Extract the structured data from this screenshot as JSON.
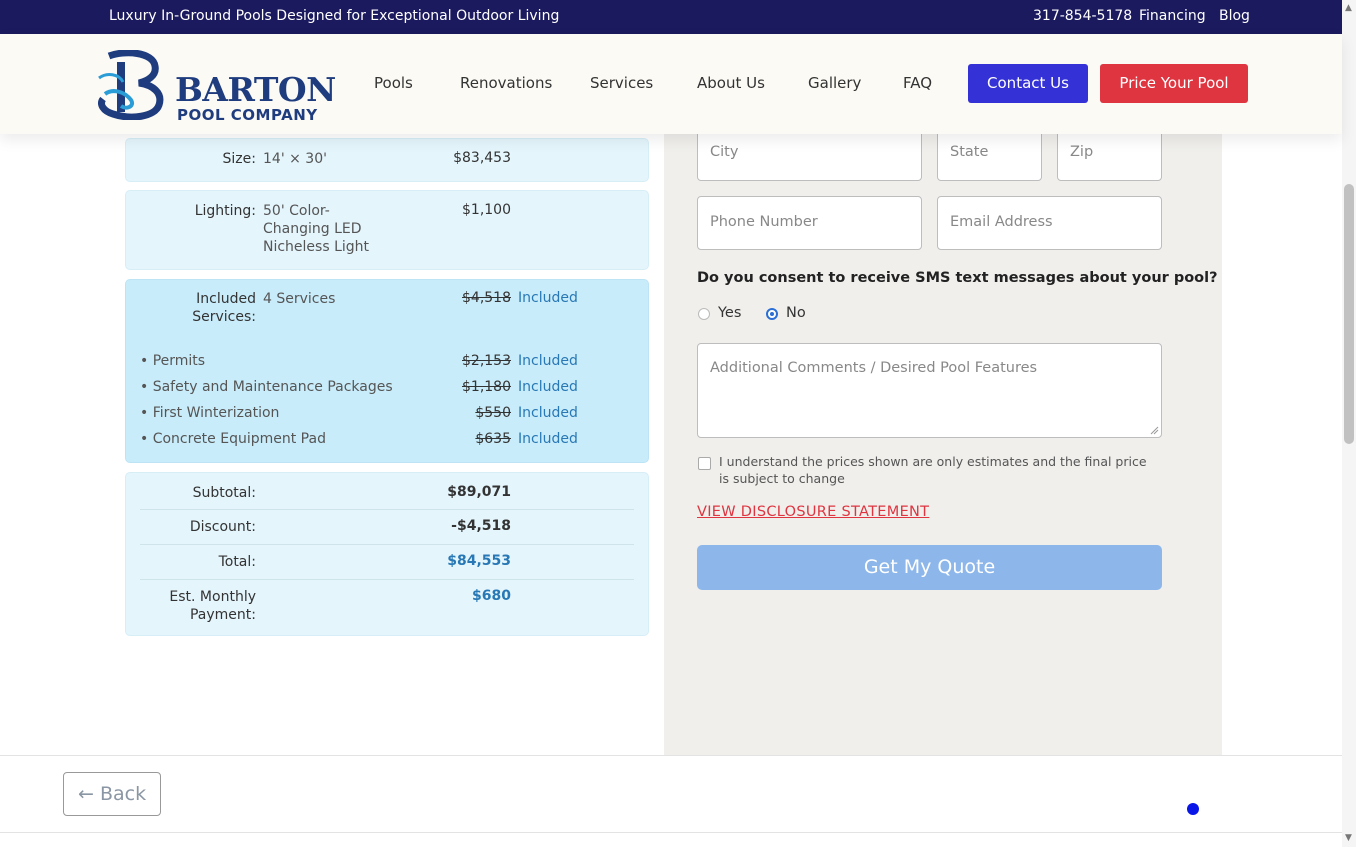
{
  "topbar": {
    "tagline": "Luxury In-Ground Pools Designed for Exceptional Outdoor Living",
    "phone": "317-854-5178",
    "financing": "Financing",
    "blog": "Blog"
  },
  "logo": {
    "line1": "BARTON",
    "line2": "POOL COMPANY"
  },
  "nav": {
    "items": [
      "Pools",
      "Renovations",
      "Services",
      "About Us",
      "Gallery",
      "FAQ"
    ],
    "contact": "Contact Us",
    "price": "Price Your Pool"
  },
  "summary": {
    "size": {
      "label": "Size:",
      "desc": "14' × 30'",
      "price": "$83,453"
    },
    "lighting": {
      "label": "Lighting:",
      "desc": "50' Color-Changing LED Nicheless Light",
      "price": "$1,100"
    },
    "included": {
      "label": "Included Services:",
      "desc": "4 Services",
      "price": "$4,518",
      "status": "Included",
      "items": [
        {
          "name": "• Permits",
          "price": "$2,153",
          "status": "Included"
        },
        {
          "name": "• Safety and Maintenance Packages",
          "price": "$1,180",
          "status": "Included"
        },
        {
          "name": "• First Winterization",
          "price": "$550",
          "status": "Included"
        },
        {
          "name": "• Concrete Equipment Pad",
          "price": "$635",
          "status": "Included"
        }
      ]
    },
    "totals": {
      "subtotal_label": "Subtotal:",
      "subtotal": "$89,071",
      "discount_label": "Discount:",
      "discount": "-$4,518",
      "total_label": "Total:",
      "total": "$84,553",
      "monthly_label": "Est. Monthly Payment:",
      "monthly": "$680"
    }
  },
  "form": {
    "city": "City",
    "state": "State",
    "zip": "Zip",
    "phone": "Phone Number",
    "email": "Email Address",
    "sms_question": "Do you consent to receive SMS text messages about your pool?",
    "sms_yes": "Yes",
    "sms_no": "No",
    "sms_selected": "No",
    "comments": "Additional Comments / Desired Pool Features",
    "ack": "I understand the prices shown are only estimates and the final price is subject to change",
    "disclosure": "VIEW DISCLOSURE STATEMENT",
    "submit": "Get My Quote"
  },
  "footer": {
    "back": "← Back"
  }
}
